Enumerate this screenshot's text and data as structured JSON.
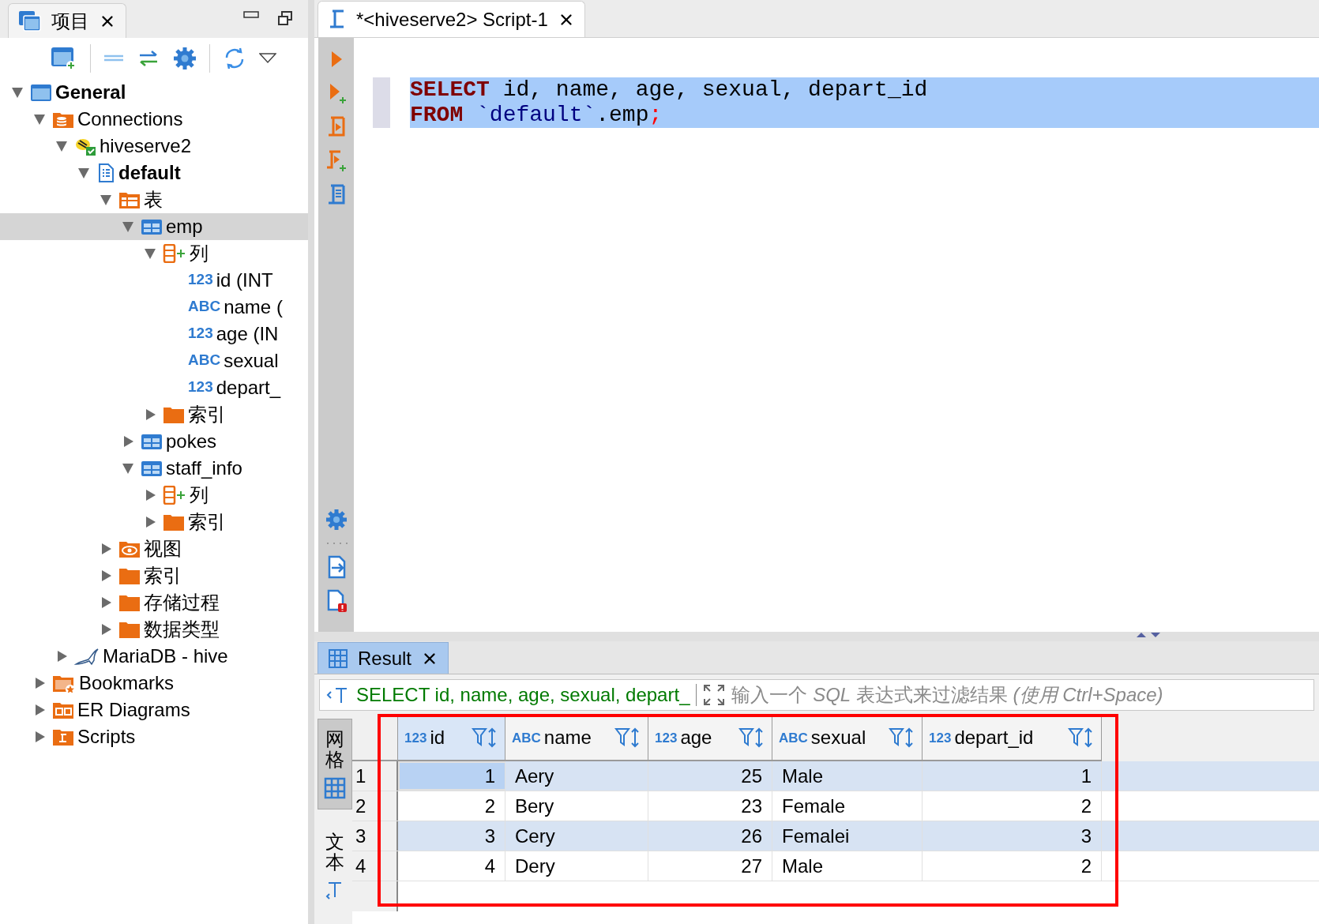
{
  "project_panel": {
    "tab": {
      "label": "项目"
    },
    "tree": [
      {
        "kind": "project",
        "label": "General",
        "bold": true,
        "selected": false,
        "expanded": true,
        "children": [
          {
            "kind": "connections",
            "label": "Connections",
            "selected": false,
            "expanded": true,
            "children": [
              {
                "kind": "hive",
                "label": "hiveserve2",
                "selected": false,
                "expanded": true,
                "children": [
                  {
                    "kind": "schema",
                    "label": "default",
                    "bold": true,
                    "selected": false,
                    "expanded": true,
                    "children": [
                      {
                        "kind": "tables",
                        "label": "表",
                        "selected": false,
                        "expanded": true,
                        "children": [
                          {
                            "kind": "table",
                            "label": "emp",
                            "selected": true,
                            "expanded": true,
                            "children": [
                              {
                                "kind": "columns",
                                "label": "列",
                                "selected": false,
                                "expanded": true,
                                "children": [
                                  {
                                    "kind": "column",
                                    "type_badge": "123",
                                    "label": "id (INT",
                                    "selected": false
                                  },
                                  {
                                    "kind": "column",
                                    "type_badge": "ABC",
                                    "label": "name (",
                                    "selected": false
                                  },
                                  {
                                    "kind": "column",
                                    "type_badge": "123",
                                    "label": "age (IN",
                                    "selected": false
                                  },
                                  {
                                    "kind": "column",
                                    "type_badge": "ABC",
                                    "label": "sexual",
                                    "selected": false
                                  },
                                  {
                                    "kind": "column",
                                    "type_badge": "123",
                                    "label": "depart_",
                                    "selected": false
                                  }
                                ]
                              },
                              {
                                "kind": "folder",
                                "label": "索引",
                                "selected": false,
                                "expanded": false
                              }
                            ]
                          },
                          {
                            "kind": "table",
                            "label": "pokes",
                            "selected": false,
                            "expanded": false
                          },
                          {
                            "kind": "table",
                            "label": "staff_info",
                            "selected": false,
                            "expanded": true,
                            "children": [
                              {
                                "kind": "columns",
                                "label": "列",
                                "selected": false,
                                "expanded": false
                              },
                              {
                                "kind": "folder",
                                "label": "索引",
                                "selected": false,
                                "expanded": false
                              }
                            ]
                          }
                        ]
                      },
                      {
                        "kind": "view",
                        "label": "视图",
                        "selected": false,
                        "expanded": false
                      },
                      {
                        "kind": "folder",
                        "label": "索引",
                        "selected": false,
                        "expanded": false
                      },
                      {
                        "kind": "folder",
                        "label": "存储过程",
                        "selected": false,
                        "expanded": false
                      },
                      {
                        "kind": "folder",
                        "label": "数据类型",
                        "selected": false,
                        "expanded": false
                      }
                    ]
                  }
                ]
              },
              {
                "kind": "mariadb",
                "label": "MariaDB - hive",
                "selected": false,
                "expanded": false
              }
            ]
          },
          {
            "kind": "bookmarks",
            "label": "Bookmarks",
            "selected": false,
            "expanded": false
          },
          {
            "kind": "er",
            "label": "ER Diagrams",
            "selected": false,
            "expanded": false
          },
          {
            "kind": "scripts",
            "label": "Scripts",
            "selected": false,
            "expanded": false
          }
        ]
      }
    ]
  },
  "editor": {
    "tab": {
      "label": "*<hiveserve2> Script-1"
    },
    "lines": [
      {
        "selected": true,
        "tokens": [
          {
            "kind": "keyword",
            "text": "SELECT"
          },
          {
            "kind": "plain",
            "text": " id, name, age, sexual, depart_id"
          }
        ]
      },
      {
        "selected": true,
        "tokens": [
          {
            "kind": "keyword",
            "text": "FROM"
          },
          {
            "kind": "identifier",
            "text": " `default`"
          },
          {
            "kind": "plain",
            "text": ".emp"
          },
          {
            "kind": "delimiter",
            "text": ";"
          }
        ]
      }
    ]
  },
  "result": {
    "tab": {
      "label": "Result"
    },
    "filter": {
      "query": "SELECT id, name, age, sexual, depart_",
      "placeholder": "输入一个 *SQL* 表达式来过滤结果 *(使用 Ctrl+Space)*"
    },
    "side_tabs": [
      {
        "label": "网格",
        "kind": "grid",
        "selected": true
      },
      {
        "label": "文本",
        "kind": "text",
        "selected": false
      }
    ],
    "columns": [
      {
        "type_badge": "123",
        "label": "id",
        "kind": "number",
        "selected": true
      },
      {
        "type_badge": "ABC",
        "label": "name",
        "kind": "text",
        "selected": false
      },
      {
        "type_badge": "123",
        "label": "age",
        "kind": "number",
        "selected": false
      },
      {
        "type_badge": "ABC",
        "label": "sexual",
        "kind": "text",
        "selected": false
      },
      {
        "type_badge": "123",
        "label": "depart_id",
        "kind": "number",
        "selected": false
      }
    ],
    "rows": [
      {
        "number": "1",
        "cells": [
          {
            "text": "1",
            "selected": true
          },
          {
            "text": "Aery",
            "selected": false
          },
          {
            "text": "25",
            "selected": false
          },
          {
            "text": "Male",
            "selected": false
          },
          {
            "text": "1",
            "selected": false
          }
        ]
      },
      {
        "number": "2",
        "cells": [
          {
            "text": "2",
            "selected": false
          },
          {
            "text": "Bery",
            "selected": false
          },
          {
            "text": "23",
            "selected": false
          },
          {
            "text": "Female",
            "selected": false
          },
          {
            "text": "2",
            "selected": false
          }
        ]
      },
      {
        "number": "3",
        "cells": [
          {
            "text": "3",
            "selected": false
          },
          {
            "text": "Cery",
            "selected": false
          },
          {
            "text": "26",
            "selected": false
          },
          {
            "text": "Femalei",
            "selected": false
          },
          {
            "text": "3",
            "selected": false
          }
        ]
      },
      {
        "number": "4",
        "cells": [
          {
            "text": "4",
            "selected": false
          },
          {
            "text": "Dery",
            "selected": false
          },
          {
            "text": "27",
            "selected": false
          },
          {
            "text": "Male",
            "selected": false
          },
          {
            "text": "2",
            "selected": false
          }
        ]
      }
    ],
    "highlight": {
      "kind": "rectangle",
      "color": "#ff0000"
    }
  }
}
